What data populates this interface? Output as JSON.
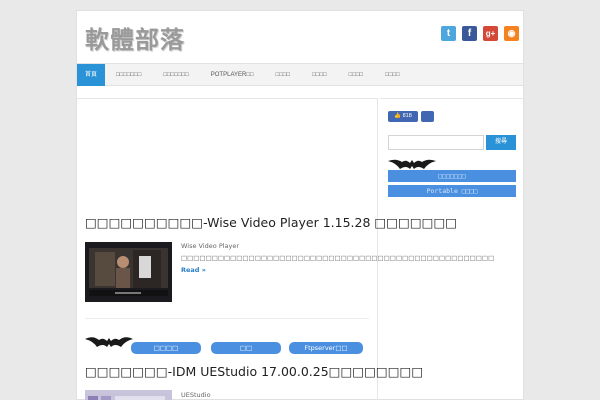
{
  "site": {
    "logo_text": "軟體部落"
  },
  "social": [
    {
      "icon": "twitter-icon",
      "glyph": "t",
      "color": "#4da7de"
    },
    {
      "icon": "facebook-icon",
      "glyph": "f",
      "color": "#3b5998"
    },
    {
      "icon": "google-plus-icon",
      "glyph": "g+",
      "color": "#d34836"
    },
    {
      "icon": "rss-icon",
      "glyph": "◉",
      "color": "#f5811f"
    }
  ],
  "nav": {
    "items": [
      "首頁",
      "□□□□□□□",
      "□□□□□□□",
      "POTPLAYER□□",
      "□□□□",
      "□□□□",
      "□□□□",
      "□□□□"
    ]
  },
  "posts": [
    {
      "title": "□□□□□□□□□□-Wise Video Player 1.15.28 □□□□□□□",
      "excerpt": "Wise Video Player □□□□□□□□□□□□□□□□□□□□□□□□□□□□□□□□□□□□□□□□□□□□□□□□□□□",
      "read_more": "Read »"
    },
    {
      "title": "□□□□□□□-IDM UEStudio 17.00.0.25□□□□□□□□",
      "excerpt": "UEStudio □□□□□□□□□□□□□□□□□□□□□□UEStudio□□□□□□□□IDE□"
    }
  ],
  "tags": [
    "□□□□",
    "□□",
    "Ftpserver□□"
  ],
  "sidebar": {
    "fb_like_count": "818",
    "search_button": "搜尋",
    "buttons": [
      "□□□□□□□",
      "Portable □□□□"
    ]
  },
  "colors": {
    "accent": "#2a92d6",
    "tag": "#4a8fe0",
    "facebook": "#4267b2"
  }
}
